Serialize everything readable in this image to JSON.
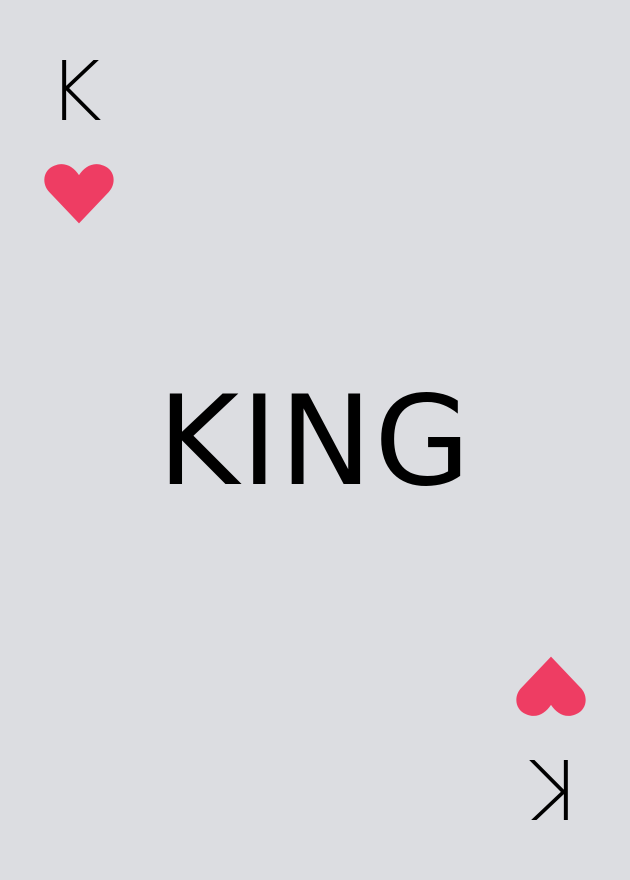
{
  "card": {
    "rank": "K",
    "suit_icon": "heart-icon",
    "name": "KING",
    "background_color": "#dcdde1",
    "ink_color": "#000000",
    "suit_color": "#ee3d63"
  }
}
